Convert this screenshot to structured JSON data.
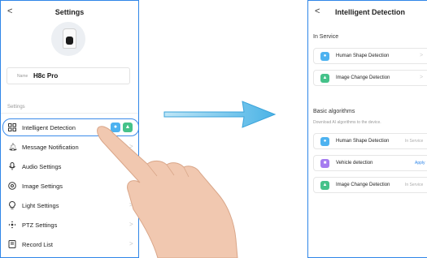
{
  "left_screen": {
    "header": {
      "back_glyph": "<",
      "title": "Settings"
    },
    "device": {
      "name_label": "Name",
      "name_value": "H8c  Pro"
    },
    "section_label": "Settings",
    "menu": [
      {
        "label": "Intelligent Detection",
        "icon": "grid-icon"
      },
      {
        "label": "Message Notification",
        "icon": "bell-icon"
      },
      {
        "label": "Audio Settings",
        "icon": "microphone-icon"
      },
      {
        "label": "Image Settings",
        "icon": "image-settings-icon"
      },
      {
        "label": "Light Settings",
        "icon": "bulb-icon"
      },
      {
        "label": "PTZ Settings",
        "icon": "ptz-icon"
      },
      {
        "label": "Record List",
        "icon": "record-list-icon"
      }
    ]
  },
  "right_screen": {
    "header": {
      "back_glyph": "<",
      "title": "Intelligent Detection"
    },
    "in_service": {
      "title": "In Service",
      "items": [
        {
          "label": "Human Shape Detection",
          "icon": "human-shape-icon"
        },
        {
          "label": "Image Change Detection",
          "icon": "image-change-icon"
        }
      ]
    },
    "basic": {
      "title": "Basic algorithms",
      "subtitle": "Download AI algorithms to the device.",
      "items": [
        {
          "label": "Human Shape Detection",
          "status": "In Service",
          "icon": "human-shape-icon"
        },
        {
          "label": "Vehicle detection",
          "status": "Apply",
          "icon": "vehicle-icon"
        },
        {
          "label": "Image Change Detection",
          "status": "In Service",
          "icon": "image-change-icon"
        }
      ]
    }
  },
  "colors": {
    "frame_border": "#2f86e8",
    "arrow": "#5bbde8",
    "hand": "#f1c8b0",
    "blue_icon": "#4db2f0",
    "green_icon": "#45c28a",
    "purple_icon": "#a57cf0"
  }
}
